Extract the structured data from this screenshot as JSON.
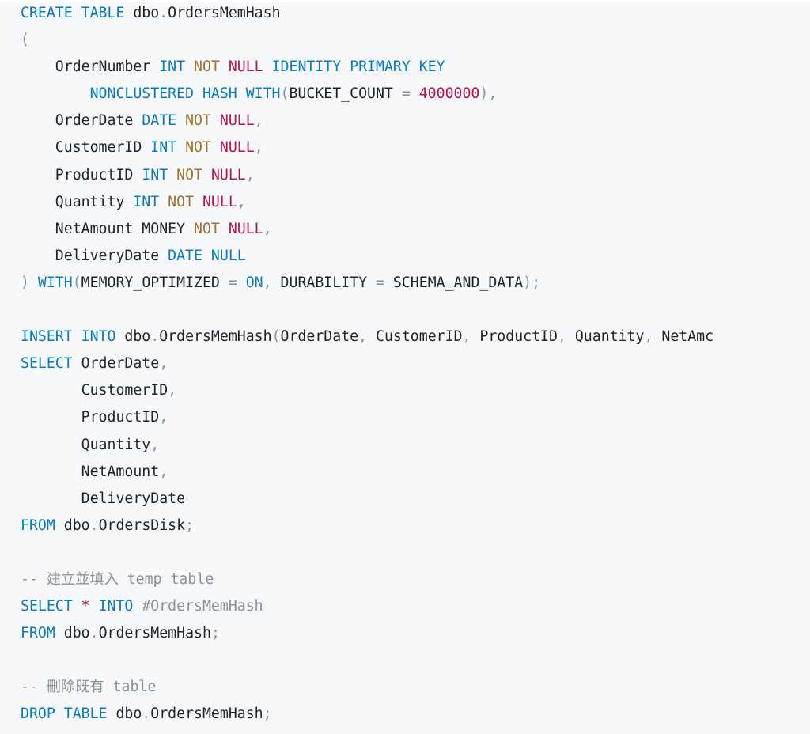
{
  "colors": {
    "background": "#f6f8fa",
    "keyword": "#0b7bb8",
    "operator": "#a07030",
    "null_and_number": "#b0164f",
    "identifier": "#1f2328",
    "punctuation": "#8a9199",
    "comment": "#8a9199"
  },
  "code_block": {
    "language": "sql",
    "lines": [
      [
        [
          "kw",
          "CREATE TABLE"
        ],
        [
          "id",
          " dbo"
        ],
        [
          "pn",
          "."
        ],
        [
          "id",
          "OrdersMemHash"
        ]
      ],
      [
        [
          "pn",
          "("
        ]
      ],
      [
        [
          "id",
          "    OrderNumber "
        ],
        [
          "ty",
          "INT"
        ],
        [
          "id",
          " "
        ],
        [
          "op",
          "NOT"
        ],
        [
          "id",
          " "
        ],
        [
          "null",
          "NULL"
        ],
        [
          "id",
          " "
        ],
        [
          "kw",
          "IDENTITY PRIMARY KEY"
        ]
      ],
      [
        [
          "id",
          "        "
        ],
        [
          "kw",
          "NONCLUSTERED HASH WITH"
        ],
        [
          "pn",
          "("
        ],
        [
          "id",
          "BUCKET_COUNT "
        ],
        [
          "pn",
          "="
        ],
        [
          "id",
          " "
        ],
        [
          "num",
          "4000000"
        ],
        [
          "pn",
          "),"
        ]
      ],
      [
        [
          "id",
          "    OrderDate "
        ],
        [
          "ty",
          "DATE"
        ],
        [
          "id",
          " "
        ],
        [
          "op",
          "NOT"
        ],
        [
          "id",
          " "
        ],
        [
          "null",
          "NULL"
        ],
        [
          "pn",
          ","
        ]
      ],
      [
        [
          "id",
          "    CustomerID "
        ],
        [
          "ty",
          "INT"
        ],
        [
          "id",
          " "
        ],
        [
          "op",
          "NOT"
        ],
        [
          "id",
          " "
        ],
        [
          "null",
          "NULL"
        ],
        [
          "pn",
          ","
        ]
      ],
      [
        [
          "id",
          "    ProductID "
        ],
        [
          "ty",
          "INT"
        ],
        [
          "id",
          " "
        ],
        [
          "op",
          "NOT"
        ],
        [
          "id",
          " "
        ],
        [
          "null",
          "NULL"
        ],
        [
          "pn",
          ","
        ]
      ],
      [
        [
          "id",
          "    Quantity "
        ],
        [
          "ty",
          "INT"
        ],
        [
          "id",
          " "
        ],
        [
          "op",
          "NOT"
        ],
        [
          "id",
          " "
        ],
        [
          "null",
          "NULL"
        ],
        [
          "pn",
          ","
        ]
      ],
      [
        [
          "id",
          "    NetAmount MONEY "
        ],
        [
          "op",
          "NOT"
        ],
        [
          "id",
          " "
        ],
        [
          "null",
          "NULL"
        ],
        [
          "pn",
          ","
        ]
      ],
      [
        [
          "id",
          "    DeliveryDate "
        ],
        [
          "ty",
          "DATE"
        ],
        [
          "id",
          " "
        ],
        [
          "kw",
          "NULL"
        ]
      ],
      [
        [
          "pn",
          ")"
        ],
        [
          "id",
          " "
        ],
        [
          "kw",
          "WITH"
        ],
        [
          "pn",
          "("
        ],
        [
          "id",
          "MEMORY_OPTIMIZED "
        ],
        [
          "pn",
          "="
        ],
        [
          "id",
          " "
        ],
        [
          "kw",
          "ON"
        ],
        [
          "pn",
          ","
        ],
        [
          "id",
          " DURABILITY "
        ],
        [
          "pn",
          "="
        ],
        [
          "id",
          " SCHEMA_AND_DATA"
        ],
        [
          "pn",
          ");"
        ]
      ],
      [],
      [
        [
          "kw",
          "INSERT INTO"
        ],
        [
          "id",
          " dbo"
        ],
        [
          "pn",
          "."
        ],
        [
          "id",
          "OrdersMemHash"
        ],
        [
          "pn",
          "("
        ],
        [
          "id",
          "OrderDate"
        ],
        [
          "pn",
          ","
        ],
        [
          "id",
          " CustomerID"
        ],
        [
          "pn",
          ","
        ],
        [
          "id",
          " ProductID"
        ],
        [
          "pn",
          ","
        ],
        [
          "id",
          " Quantity"
        ],
        [
          "pn",
          ","
        ],
        [
          "id",
          " NetAmc"
        ]
      ],
      [
        [
          "kw",
          "SELECT"
        ],
        [
          "id",
          " OrderDate"
        ],
        [
          "pn",
          ","
        ]
      ],
      [
        [
          "id",
          "       CustomerID"
        ],
        [
          "pn",
          ","
        ]
      ],
      [
        [
          "id",
          "       ProductID"
        ],
        [
          "pn",
          ","
        ]
      ],
      [
        [
          "id",
          "       Quantity"
        ],
        [
          "pn",
          ","
        ]
      ],
      [
        [
          "id",
          "       NetAmount"
        ],
        [
          "pn",
          ","
        ]
      ],
      [
        [
          "id",
          "       DeliveryDate"
        ]
      ],
      [
        [
          "kw",
          "FROM"
        ],
        [
          "id",
          " dbo"
        ],
        [
          "pn",
          "."
        ],
        [
          "id",
          "OrdersDisk"
        ],
        [
          "pn",
          ";"
        ]
      ],
      [],
      [
        [
          "com",
          "-- 建立並填入 temp table"
        ]
      ],
      [
        [
          "kw",
          "SELECT"
        ],
        [
          "id",
          " "
        ],
        [
          "sym",
          "*"
        ],
        [
          "id",
          " "
        ],
        [
          "kw",
          "INTO"
        ],
        [
          "id",
          " "
        ],
        [
          "pn",
          "#OrdersMemHash"
        ]
      ],
      [
        [
          "kw",
          "FROM"
        ],
        [
          "id",
          " dbo"
        ],
        [
          "pn",
          "."
        ],
        [
          "id",
          "OrdersMemHash"
        ],
        [
          "pn",
          ";"
        ]
      ],
      [],
      [
        [
          "com",
          "-- 刪除既有 table"
        ]
      ],
      [
        [
          "kw",
          "DROP TABLE"
        ],
        [
          "id",
          " dbo"
        ],
        [
          "pn",
          "."
        ],
        [
          "id",
          "OrdersMemHash"
        ],
        [
          "pn",
          ";"
        ]
      ]
    ]
  }
}
